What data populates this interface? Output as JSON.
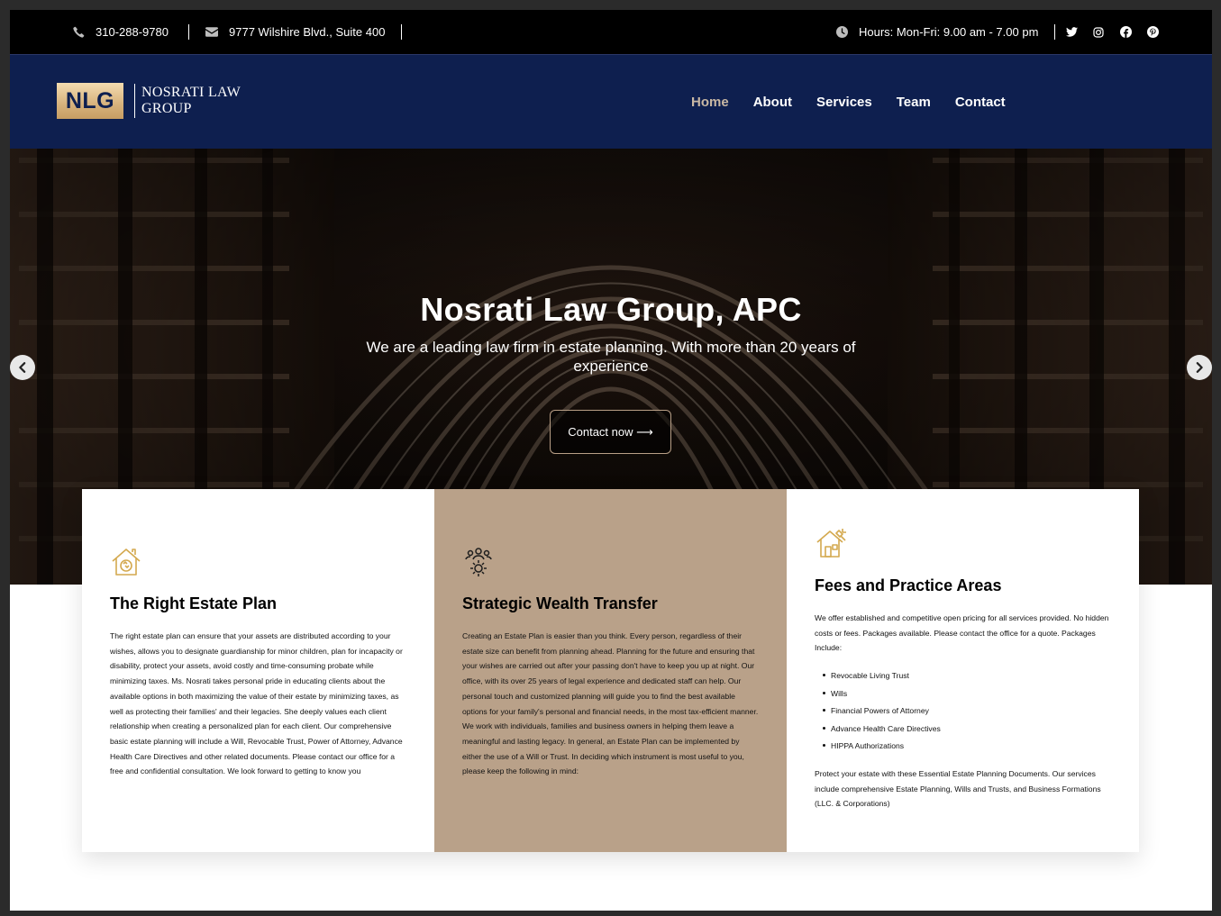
{
  "topbar": {
    "phone": "310-288-9780",
    "address": "9777 Wilshire Blvd., Suite 400",
    "hours": "Hours: Mon-Fri: 9.00 am - 7.00 pm",
    "social": [
      "twitter-icon",
      "instagram-icon",
      "facebook-icon",
      "pinterest-icon"
    ]
  },
  "header": {
    "logo_mark": "NLG",
    "logo_line1": "NOSRATI LAW",
    "logo_line2": "GROUP",
    "nav": [
      {
        "label": "Home",
        "active": true
      },
      {
        "label": "About",
        "active": false
      },
      {
        "label": "Services",
        "active": false
      },
      {
        "label": "Team",
        "active": false
      },
      {
        "label": "Contact",
        "active": false
      }
    ]
  },
  "hero": {
    "title": "Nosrati Law Group, APC",
    "subtitle": "We are a leading law firm in estate planning. With more than 20 years of experience",
    "button": "Contact now ⟶"
  },
  "cards": [
    {
      "icon": "house-recycle-icon",
      "title": "The Right Estate Plan",
      "body": "The right estate plan can ensure that your assets are distributed according to your wishes, allows you to designate guardianship for minor children, plan for incapacity or disability, protect your assets, avoid costly and time-consuming probate while minimizing taxes. Ms. Nosrati takes personal pride in educating clients about the available options in both maximizing the value of their estate by minimizing taxes, as well as protecting their families' and their legacies. She deeply values each client relationship when creating a personalized plan for each client. Our comprehensive basic estate planning will include a Will, Revocable Trust, Power of Attorney, Advance Health Care Directives and other related documents. Please contact our office for a free and confidential consultation. We look forward to getting to know you"
    },
    {
      "icon": "people-gear-icon",
      "title": "Strategic Wealth Transfer",
      "body": "Creating an Estate Plan is easier than you think. Every person, regardless of their estate size can benefit from planning ahead.   Planning for the future and ensuring that your wishes are carried out after your passing don't have to keep you up at night. Our office, with its over 25 years of legal experience and dedicated staff can help. Our personal touch and customized planning will guide you to find the best available options for your family's personal and financial needs, in the most tax-efficient manner.   We work with individuals, families and business owners in helping them leave a meaningful and lasting legacy. In general, an Estate Plan can be implemented by either the use of a Will or Trust. In deciding which instrument is most useful to you, please keep the following in mind:"
    },
    {
      "icon": "house-tools-icon",
      "title": "Fees and Practice Areas",
      "intro": "We offer established and competitive open pricing for all services provided. No hidden costs or fees. Packages available. Please contact the office for a quote. Packages Include:",
      "list": [
        "Revocable Living Trust",
        "Wills",
        "Financial Powers of Attorney",
        "Advance Health Care Directives",
        "HIPPA Authorizations"
      ],
      "outro": "Protect your estate with these Essential Estate Planning Documents. Our services include comprehensive Estate Planning, Wills and Trusts, and Business Formations (LLC. & Corporations)"
    }
  ],
  "colors": {
    "topbar_bg": "#000000",
    "header_bg": "#0e1f4f",
    "nav_active": "#c9b8a4",
    "accent_gold": "#d4a94f",
    "card_mid_bg": "#b9a189"
  }
}
